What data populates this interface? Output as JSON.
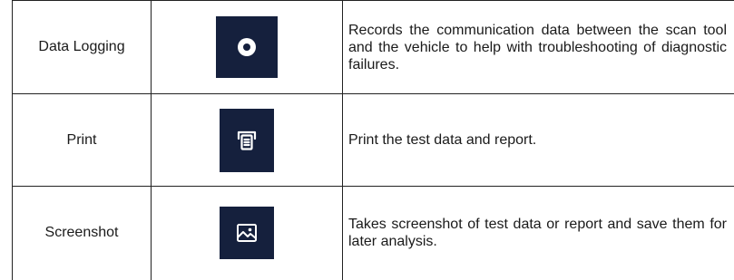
{
  "rows": [
    {
      "name": "Data Logging",
      "icon": "record-icon",
      "description": "Records the communication data between the scan tool and the vehicle to help with troubleshooting of diagnostic failures."
    },
    {
      "name": "Print",
      "icon": "printer-icon",
      "description": "Print the test data and report."
    },
    {
      "name": "Screenshot",
      "icon": "image-icon",
      "description": "Takes screenshot of test data or report and save them for later analysis."
    }
  ],
  "colors": {
    "icon_background": "#15203d",
    "icon_foreground": "#ffffff",
    "grid_line": "#222222",
    "text": "#1a1a1a"
  }
}
